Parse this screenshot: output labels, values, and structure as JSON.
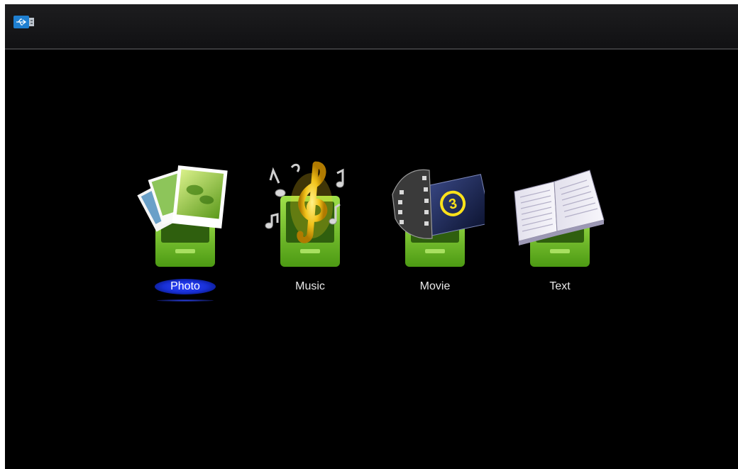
{
  "status_bar": {
    "device_icon": "usb-drive-icon"
  },
  "menu": {
    "selected": "Photo",
    "items": [
      {
        "label": "Photo",
        "icon": "photo-stack-icon"
      },
      {
        "label": "Music",
        "icon": "music-notes-icon"
      },
      {
        "label": "Movie",
        "icon": "film-reel-icon"
      },
      {
        "label": "Text",
        "icon": "open-book-icon"
      }
    ]
  },
  "colors": {
    "background": "#000000",
    "drawer_green": "#6bbf2a",
    "selection_blue": "#1f3cff"
  }
}
